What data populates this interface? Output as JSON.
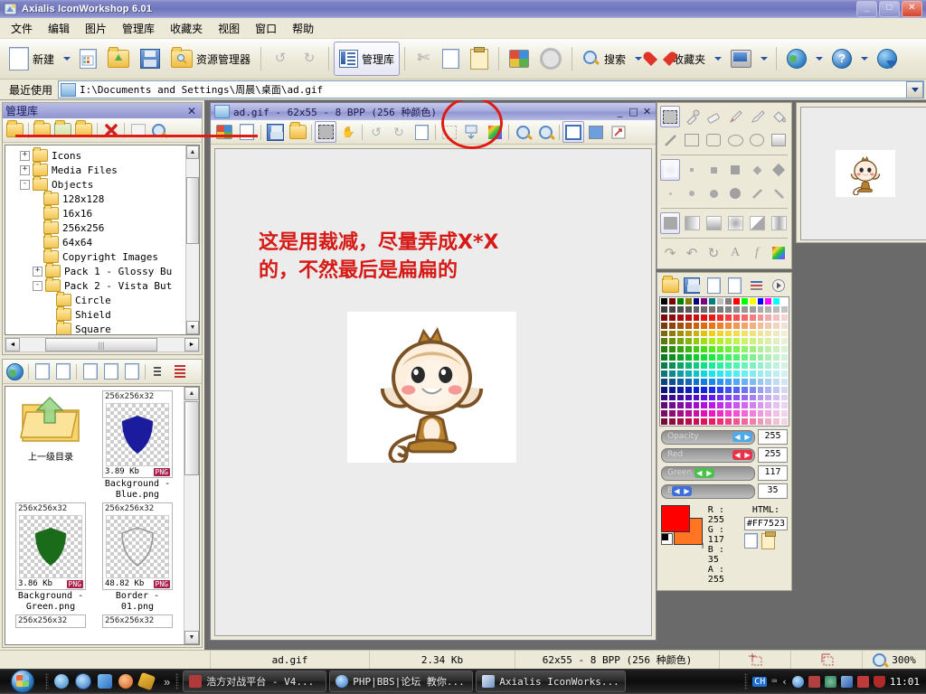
{
  "window": {
    "title": "Axialis IconWorkshop 6.01",
    "minimize": "_",
    "maximize": "□",
    "close": "✕"
  },
  "menu": {
    "items": [
      "文件",
      "编辑",
      "图片",
      "管理库",
      "收藏夹",
      "视图",
      "窗口",
      "帮助"
    ]
  },
  "toolbar": {
    "new_label": "新建",
    "explorer_label": "资源管理器",
    "library_label": "管理库",
    "search_label": "搜索",
    "favorites_label": "收藏夹",
    "icons": [
      "new-document-icon",
      "dropdown-caret",
      "new-image-icon",
      "open-folder-icon",
      "save-icon",
      "explorer-icon",
      "undo-icon",
      "redo-icon",
      "library-icon",
      "cut-icon",
      "copy-icon",
      "paste-icon",
      "windows-icon",
      "settings-gear-icon",
      "search-icon",
      "favorites-heart-icon",
      "monitor-icon",
      "globe-icon",
      "help-icon",
      "download-globe-icon"
    ]
  },
  "recent": {
    "label": "最近使用",
    "path": "I:\\Documents and Settings\\周晨\\桌面\\ad.gif"
  },
  "library_panel": {
    "title": "管理库",
    "close": "✕",
    "tree": [
      {
        "indent": 1,
        "toggle": "+",
        "label": "Icons"
      },
      {
        "indent": 1,
        "toggle": "+",
        "label": "Media Files"
      },
      {
        "indent": 1,
        "toggle": "-",
        "label": "Objects"
      },
      {
        "indent": 2,
        "toggle": "",
        "label": "128x128"
      },
      {
        "indent": 2,
        "toggle": "",
        "label": "16x16"
      },
      {
        "indent": 2,
        "toggle": "",
        "label": "256x256"
      },
      {
        "indent": 2,
        "toggle": "",
        "label": "64x64"
      },
      {
        "indent": 2,
        "toggle": "",
        "label": "Copyright Images"
      },
      {
        "indent": 2,
        "toggle": "+",
        "label": "Pack 1 - Glossy Bu"
      },
      {
        "indent": 2,
        "toggle": "-",
        "label": "Pack 2 - Vista But"
      },
      {
        "indent": 3,
        "toggle": "",
        "label": "Circle"
      },
      {
        "indent": 3,
        "toggle": "",
        "label": "Shield"
      },
      {
        "indent": 3,
        "toggle": "",
        "label": "Square"
      }
    ]
  },
  "thumbnails": {
    "up_label": "上一级目录",
    "items": [
      {
        "dim": "256x256x32",
        "size": "3.89 Kb",
        "format": "PNG",
        "name": "Background - Blue.png",
        "color": "#1b1b9e",
        "shape": "shield"
      },
      {
        "dim": "256x256x32",
        "size": "3.86 Kb",
        "format": "PNG",
        "name": "Background - Green.png",
        "color": "#1a6b1a",
        "shape": "shield"
      },
      {
        "dim": "256x256x32",
        "size": "48.82 Kb",
        "format": "PNG",
        "name": "Border - 01.png",
        "color": "#9a9a9a",
        "shape": "shield-outline"
      },
      {
        "dim": "256x256x32",
        "size": "",
        "format": "",
        "name": "",
        "color": "#cccccc",
        "shape": "none"
      },
      {
        "dim": "256x256x32",
        "size": "",
        "format": "",
        "name": "",
        "color": "#cccccc",
        "shape": "none"
      }
    ]
  },
  "document_window": {
    "title": "ad.gif - 62x55 - 8 BPP (256 种颜色)",
    "minimize": "_",
    "maximize": "□",
    "close": "✕",
    "annotation": "这是用裁减，尽量弄成X*X的，不然最后是扁扁的",
    "annotation_color": "#d61a16"
  },
  "tool_palette": {
    "row1": [
      "select-rectangle-tool",
      "eyedropper-tool",
      "eraser-tool",
      "pencil-tool",
      "paintbrush-tool",
      "paint-bucket-tool"
    ],
    "row2": [
      "line-tool",
      "rectangle-tool",
      "rounded-rectangle-tool",
      "ellipse-tool",
      "circle-tool",
      "gradient-rectangle-tool"
    ],
    "brushes_row1": [
      "brush-soft",
      "brush-dot-1",
      "brush-square-2",
      "brush-square-3",
      "brush-diamond-1",
      "brush-diamond-2"
    ],
    "brushes_row2": [
      "brush-dot-tiny",
      "brush-dot-small",
      "brush-circle-med",
      "brush-circle-large",
      "brush-slash-1",
      "brush-slash-2"
    ],
    "fills": [
      "fill-solid",
      "fill-linear-left",
      "fill-linear-down",
      "fill-radial",
      "fill-diagonal",
      "fill-mirror"
    ],
    "effects": [
      "rotate-icon",
      "flip-icon",
      "rotate-cw-icon",
      "text-tool",
      "effects-tool",
      "color-picker-tool"
    ]
  },
  "palette_panel": {
    "tools": [
      "open-palette-icon",
      "save-palette-icon",
      "new-palette-icon",
      "delete-palette-icon",
      "list-palette-icon",
      "play-palette-icon"
    ],
    "sliders": [
      {
        "name": "Opacity",
        "value": "255",
        "knob_color": "#4fa8e8",
        "fill_pct": 100
      },
      {
        "name": "Red",
        "value": "255",
        "knob_color": "#e8344a",
        "fill_pct": 100
      },
      {
        "name": "Green",
        "value": "117",
        "knob_color": "#4bc04b",
        "fill_pct": 46
      },
      {
        "name": "B",
        "value": "35",
        "knob_color": "#3d6fd8",
        "fill_pct": 14
      }
    ],
    "rgb": [
      {
        "ch": "R",
        "val": "255"
      },
      {
        "ch": "G",
        "val": "117"
      },
      {
        "ch": "B",
        "val": "35"
      },
      {
        "ch": "A",
        "val": "255"
      }
    ],
    "html_label": "HTML:",
    "html_value": "#FF7523",
    "fg_color": "#ff0000",
    "bg_color": "#ff7523"
  },
  "status_bar": {
    "file": "ad.gif",
    "size": "2.34 Kb",
    "format": "62x55 - 8 BPP (256 种颜色)",
    "zoom": "300%"
  },
  "taskbar": {
    "start": "start-orb",
    "quick_launch": [
      "internet-explorer-icon",
      "maxthon-icon",
      "app-icon",
      "media-player-icon",
      "flash-icon"
    ],
    "overflow": "»",
    "tasks": [
      {
        "icon": "haofang-icon",
        "label": "浩方对战平台 - V4..."
      },
      {
        "icon": "maxthon-icon",
        "label": "PHP|BBS|论坛 教你..."
      },
      {
        "icon": "iconworkshop-icon",
        "label": "Axialis IconWorks..."
      }
    ],
    "tray": {
      "ime": "CH",
      "items": [
        "ime-indicator",
        "arrow-icon",
        "maxthon-tray-icon",
        "haofang-tray-icon",
        "net-tray-icon",
        "monitor-tray-icon",
        "warning-tray-icon",
        "shield-tray-icon"
      ],
      "clock": "11:01"
    }
  }
}
